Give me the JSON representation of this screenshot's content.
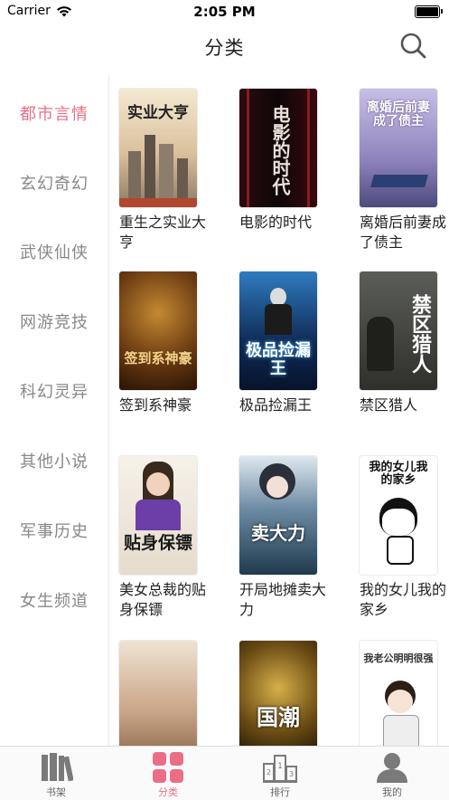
{
  "status": {
    "carrier": "Carrier",
    "time": "2:05 PM"
  },
  "nav": {
    "title": "分类"
  },
  "sidebar": {
    "items": [
      {
        "label": "都市言情"
      },
      {
        "label": "玄幻奇幻"
      },
      {
        "label": "武侠仙侠"
      },
      {
        "label": "网游竞技"
      },
      {
        "label": "科幻灵异"
      },
      {
        "label": "其他小说"
      },
      {
        "label": "军事历史"
      },
      {
        "label": "女生频道"
      }
    ]
  },
  "books": [
    {
      "title": "重生之实业大亨",
      "cover_text": "实业大亨",
      "bg": "#e9d9b9",
      "fg": "#222"
    },
    {
      "title": "电影的时代",
      "cover_text": "电影的时代",
      "bg": "#1a0c0e",
      "fg": "#e8e1d8"
    },
    {
      "title": "离婚后前妻成了债主",
      "cover_text": "离婚后前妻成了债主",
      "bg": "#a597c9",
      "fg": "#fff"
    },
    {
      "title": "签到系神豪",
      "cover_text": "签到系神豪",
      "bg": "#5a3414",
      "fg": "#f3d38b"
    },
    {
      "title": "极品捡漏王",
      "cover_text": "极品捡漏王",
      "bg": "#0f2a55",
      "fg": "#fff"
    },
    {
      "title": "禁区猎人",
      "cover_text": "禁区猎人",
      "bg": "#3a3b36",
      "fg": "#fff"
    },
    {
      "title": "美女总裁的贴身保镖",
      "cover_text": "贴身保镖",
      "bg": "#efe9e3",
      "fg": "#1a1a1a"
    },
    {
      "title": "开局地摊卖大力",
      "cover_text": "卖大力",
      "bg": "#203a4d",
      "fg": "#fff"
    },
    {
      "title": "我的女儿我的家乡",
      "cover_text": "我的女儿我的家乡",
      "bg": "#ffffff",
      "fg": "#111"
    },
    {
      "title": "",
      "cover_text": "",
      "bg": "#d9b99c",
      "fg": "#8b1d12"
    },
    {
      "title": "",
      "cover_text": "国潮",
      "bg": "#2a1f0a",
      "fg": "#f4d35b"
    },
    {
      "title": "",
      "cover_text": "我老公明明很强",
      "bg": "#ffffff",
      "fg": "#333"
    }
  ],
  "tabs": [
    {
      "label": "书架",
      "icon": "bookshelf-icon"
    },
    {
      "label": "分类",
      "icon": "category-icon"
    },
    {
      "label": "排行",
      "icon": "ranking-icon"
    },
    {
      "label": "我的",
      "icon": "profile-icon"
    }
  ],
  "colors": {
    "accent": "#ea6f86",
    "inactive": "#888888"
  }
}
